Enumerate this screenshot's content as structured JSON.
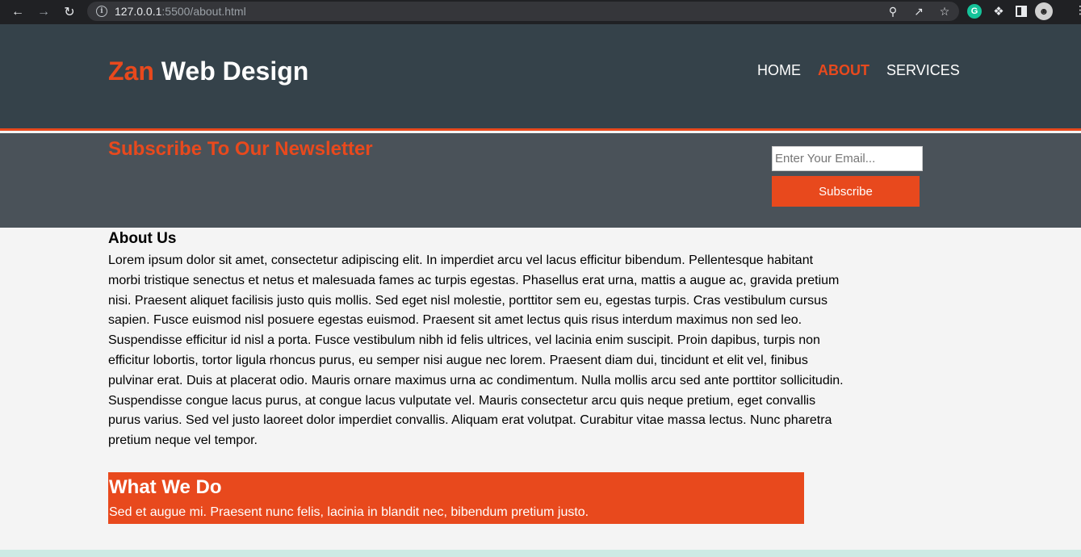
{
  "browser": {
    "url_host": "127.0.0.1",
    "url_rest": ":5500/about.html"
  },
  "header": {
    "brand_accent": "Zan",
    "brand_rest": " Web Design",
    "nav": [
      {
        "label": "HOME",
        "current": false
      },
      {
        "label": "ABOUT",
        "current": true
      },
      {
        "label": "SERVICES",
        "current": false
      }
    ]
  },
  "newsletter": {
    "title": "Subscribe To Our Newsletter",
    "email_placeholder": "Enter Your Email...",
    "button_label": "Subscribe"
  },
  "about": {
    "title": "About Us",
    "paragraph_1": "Lorem ipsum dolor sit amet, consectetur adipiscing elit. In imperdiet arcu vel lacus efficitur bibendum. Pellentesque habitant morbi tristique senectus et netus et malesuada fames ac turpis egestas. Phasellus erat urna, mattis a augue ac, gravida pretium nisi. Praesent aliquet facilisis justo quis mollis. Sed eget nisl molestie, porttitor sem eu, egestas turpis. Cras vestibulum cursus sapien. Fusce euismod nisl posuere egestas euismod. Praesent sit amet lectus quis risus interdum maximus non sed leo.",
    "paragraph_2": "Suspendisse efficitur id nisl a porta. Fusce vestibulum nibh id felis ultrices, vel lacinia enim suscipit. Proin dapibus, turpis non efficitur lobortis, tortor ligula rhoncus purus, eu semper nisi augue nec lorem. Praesent diam dui, tincidunt et elit vel, finibus pulvinar erat. Duis at placerat odio. Mauris ornare maximus urna ac condimentum. Nulla mollis arcu sed ante porttitor sollicitudin. Suspendisse congue lacus purus, at congue lacus vulputate vel. Mauris consectetur arcu quis neque pretium, eget convallis purus varius. Sed vel justo laoreet dolor imperdiet convallis. Aliquam erat volutpat. Curabitur vitae massa lectus. Nunc pharetra pretium neque vel tempor."
  },
  "what_we_do": {
    "title": "What We Do",
    "text": "Sed et augue mi. Praesent nunc felis, lacinia in blandit nec, bibendum pretium justo."
  },
  "colors": {
    "accent": "#e8491d",
    "header_bg": "#35424a",
    "newsletter_bg": "#4a5259",
    "page_bg": "#f4f4f4"
  }
}
